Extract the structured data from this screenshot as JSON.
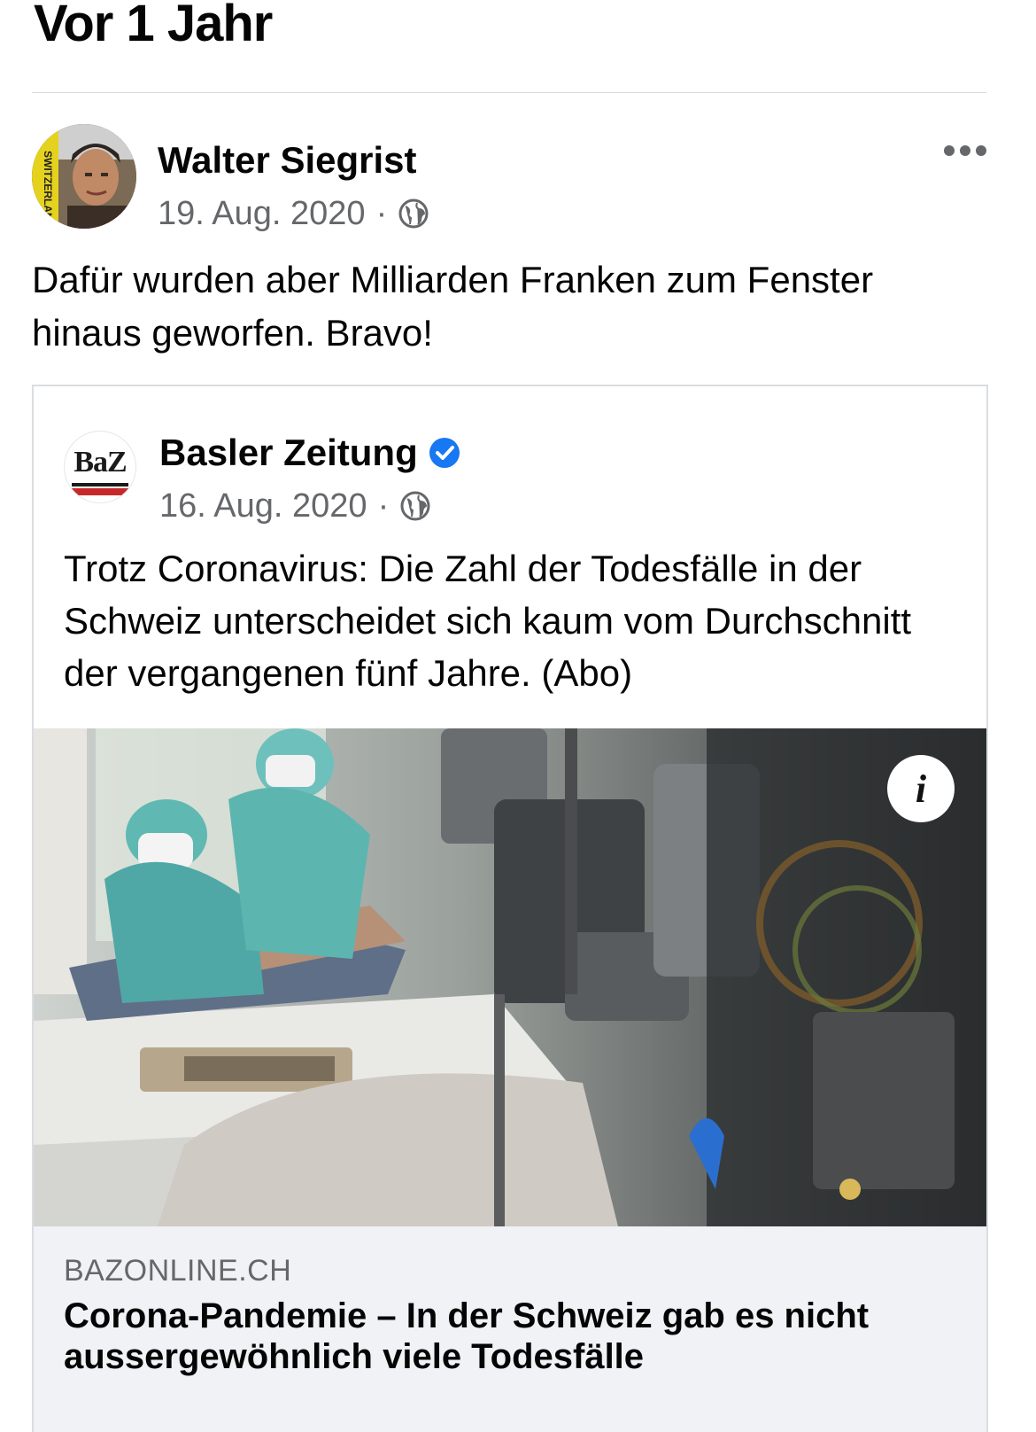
{
  "section": {
    "title": "Vor 1 Jahr"
  },
  "post": {
    "author": "Walter Siegrist",
    "date": "19. Aug. 2020",
    "separator": "·",
    "privacy_icon": "globe-icon",
    "more_icon": "more-options-icon",
    "text": "Dafür wurden aber Milliarden Franken zum Fenster hinaus geworfen. Bravo!"
  },
  "shared": {
    "page_name": "Basler Zeitung",
    "logo_text": "BaZ",
    "verified_icon": "verified-badge-icon",
    "date": "16. Aug. 2020",
    "separator": "·",
    "privacy_icon": "globe-icon",
    "text": "Trotz Coronavirus: Die Zahl der Todesfälle in der Schweiz unterscheidet sich kaum vom Durchschnitt der vergangenen fünf Jahre. (Abo)",
    "info_icon": "info-icon",
    "info_glyph": "i",
    "link": {
      "domain": "BAZONLINE.CH",
      "headline": "Corona-Pandemie – In der Schweiz gab es nicht aussergewöhnlich viele Todesfälle"
    }
  },
  "colors": {
    "text": "#050505",
    "secondary": "#65676b",
    "verified": "#1877f2",
    "link_bg": "#f0f2f5",
    "baz_red": "#c62828"
  }
}
